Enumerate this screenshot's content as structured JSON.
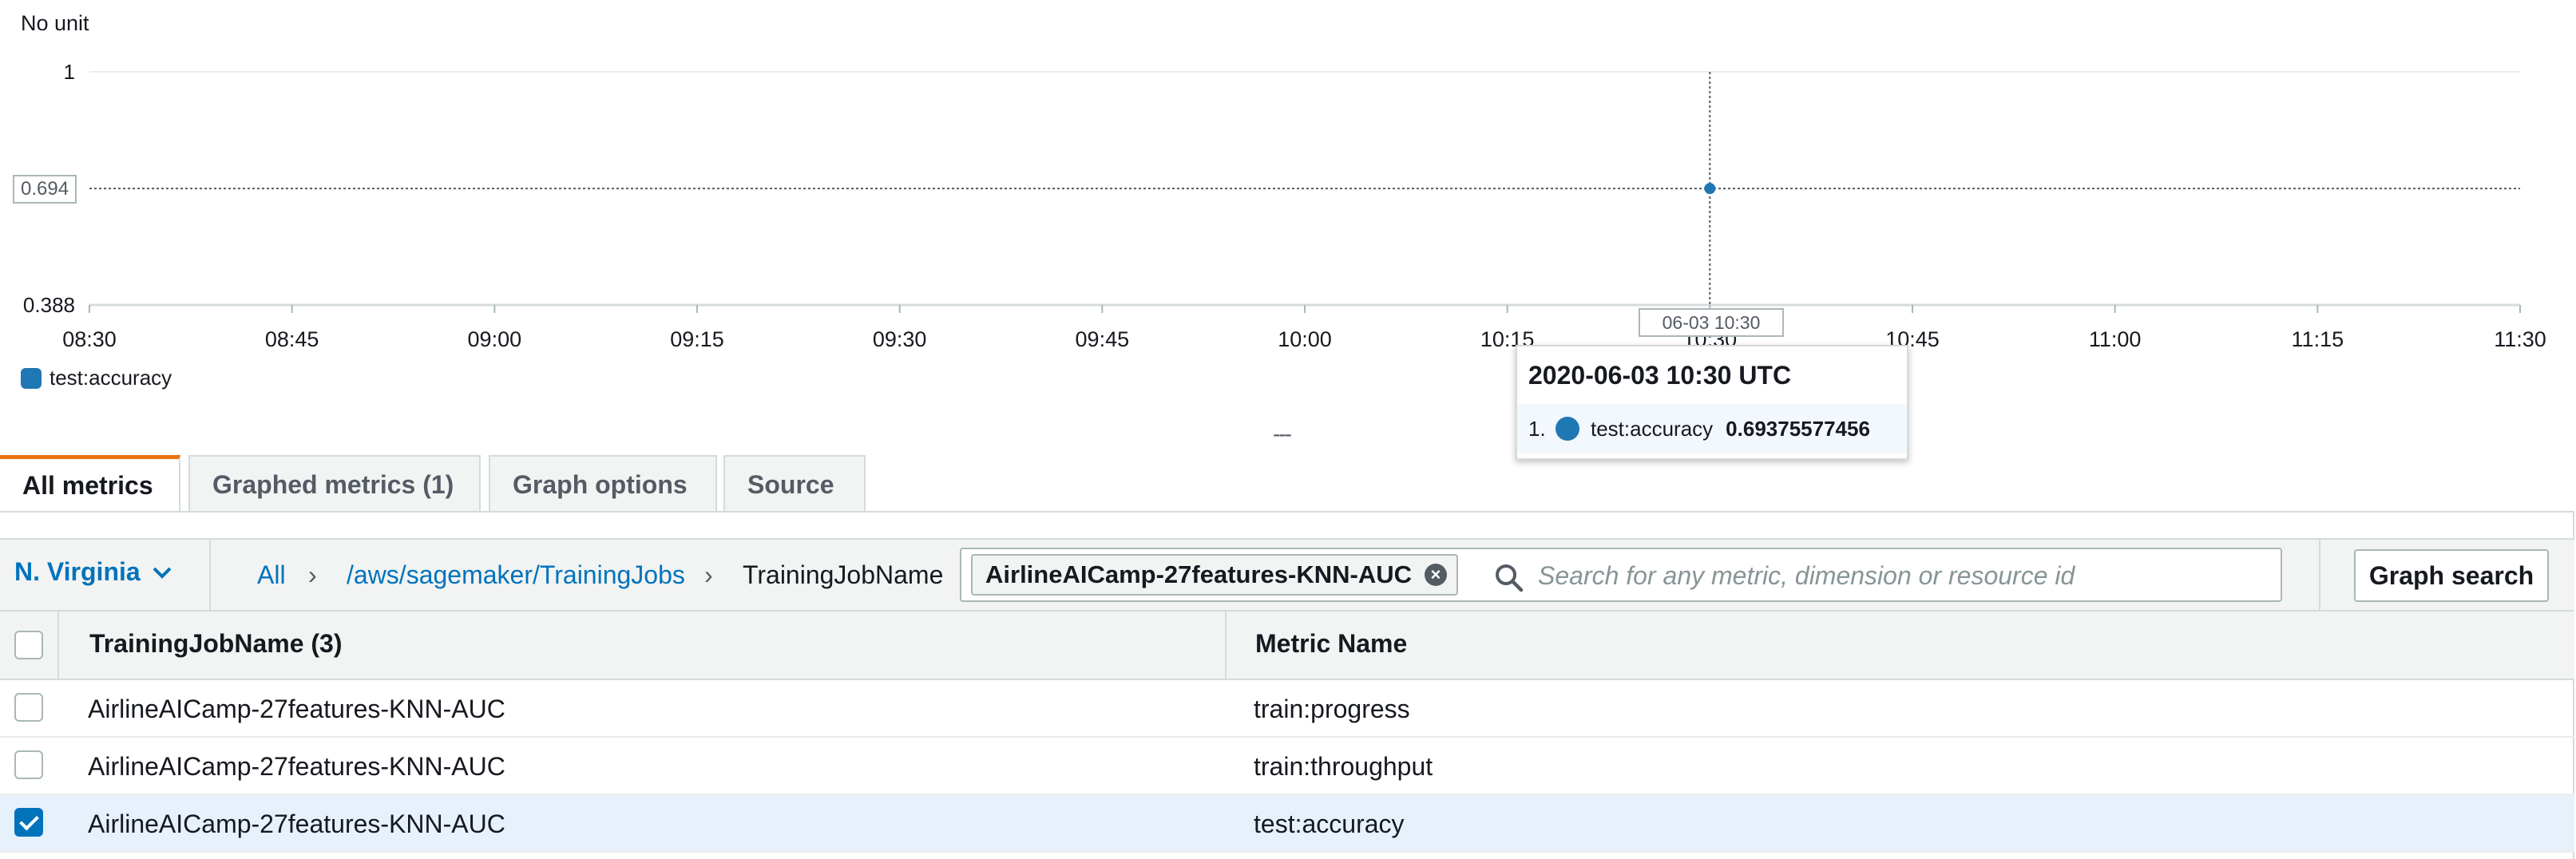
{
  "chart": {
    "unit_label": "No unit",
    "y_ticks": [
      "1",
      "0.388"
    ],
    "y_crosshair_label": "0.694",
    "x_ticks": [
      "08:30",
      "08:45",
      "09:00",
      "09:15",
      "09:30",
      "09:45",
      "10:00",
      "10:15",
      "10:30",
      "10:45",
      "11:00",
      "11:15",
      "11:30"
    ],
    "x_crosshair_label": "06-03 10:30",
    "legend": [
      {
        "label": "test:accuracy",
        "color": "#1f77b4"
      }
    ],
    "tooltip": {
      "title": "2020-06-03 10:30 UTC",
      "rows": [
        {
          "index": "1.",
          "name": "test:accuracy",
          "value": "0.69375577456"
        }
      ]
    },
    "resize_handle": "---"
  },
  "chart_data": {
    "type": "line",
    "xlabel": "",
    "ylabel": "No unit",
    "ylim": [
      0.388,
      1
    ],
    "x_range": [
      "08:30",
      "11:30"
    ],
    "series": [
      {
        "name": "test:accuracy",
        "color": "#1f77b4",
        "x": [
          "10:30"
        ],
        "values": [
          0.69375577456
        ]
      }
    ],
    "grid": true,
    "legend_position": "bottom-left"
  },
  "tabs": [
    {
      "label": "All metrics",
      "active": true
    },
    {
      "label": "Graphed metrics (1)",
      "active": false
    },
    {
      "label": "Graph options",
      "active": false
    },
    {
      "label": "Source",
      "active": false
    }
  ],
  "filter_bar": {
    "region": "N. Virginia",
    "breadcrumbs": [
      "All",
      "/aws/sagemaker/TrainingJobs",
      "TrainingJobName"
    ],
    "separator": "›",
    "token": "AirlineAICamp-27features-KNN-AUC",
    "search_placeholder": "Search for any metric, dimension or resource id",
    "graph_search_label": "Graph search"
  },
  "table": {
    "columns": [
      "TrainingJobName (3)",
      "Metric Name"
    ],
    "rows": [
      {
        "job": "AirlineAICamp-27features-KNN-AUC",
        "metric": "train:progress",
        "checked": false
      },
      {
        "job": "AirlineAICamp-27features-KNN-AUC",
        "metric": "train:throughput",
        "checked": false
      },
      {
        "job": "AirlineAICamp-27features-KNN-AUC",
        "metric": "test:accuracy",
        "checked": true
      }
    ]
  },
  "colors": {
    "accent": "#0073bb",
    "tab_active": "#ec7211",
    "series": "#1f77b4"
  }
}
